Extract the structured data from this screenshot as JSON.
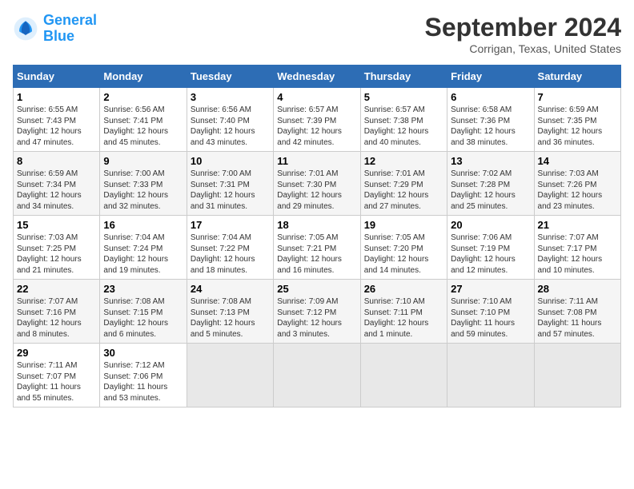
{
  "header": {
    "logo_line1": "General",
    "logo_line2": "Blue",
    "month_title": "September 2024",
    "location": "Corrigan, Texas, United States"
  },
  "weekdays": [
    "Sunday",
    "Monday",
    "Tuesday",
    "Wednesday",
    "Thursday",
    "Friday",
    "Saturday"
  ],
  "weeks": [
    [
      {
        "day": "1",
        "info": "Sunrise: 6:55 AM\nSunset: 7:43 PM\nDaylight: 12 hours\nand 47 minutes."
      },
      {
        "day": "2",
        "info": "Sunrise: 6:56 AM\nSunset: 7:41 PM\nDaylight: 12 hours\nand 45 minutes."
      },
      {
        "day": "3",
        "info": "Sunrise: 6:56 AM\nSunset: 7:40 PM\nDaylight: 12 hours\nand 43 minutes."
      },
      {
        "day": "4",
        "info": "Sunrise: 6:57 AM\nSunset: 7:39 PM\nDaylight: 12 hours\nand 42 minutes."
      },
      {
        "day": "5",
        "info": "Sunrise: 6:57 AM\nSunset: 7:38 PM\nDaylight: 12 hours\nand 40 minutes."
      },
      {
        "day": "6",
        "info": "Sunrise: 6:58 AM\nSunset: 7:36 PM\nDaylight: 12 hours\nand 38 minutes."
      },
      {
        "day": "7",
        "info": "Sunrise: 6:59 AM\nSunset: 7:35 PM\nDaylight: 12 hours\nand 36 minutes."
      }
    ],
    [
      {
        "day": "8",
        "info": "Sunrise: 6:59 AM\nSunset: 7:34 PM\nDaylight: 12 hours\nand 34 minutes."
      },
      {
        "day": "9",
        "info": "Sunrise: 7:00 AM\nSunset: 7:33 PM\nDaylight: 12 hours\nand 32 minutes."
      },
      {
        "day": "10",
        "info": "Sunrise: 7:00 AM\nSunset: 7:31 PM\nDaylight: 12 hours\nand 31 minutes."
      },
      {
        "day": "11",
        "info": "Sunrise: 7:01 AM\nSunset: 7:30 PM\nDaylight: 12 hours\nand 29 minutes."
      },
      {
        "day": "12",
        "info": "Sunrise: 7:01 AM\nSunset: 7:29 PM\nDaylight: 12 hours\nand 27 minutes."
      },
      {
        "day": "13",
        "info": "Sunrise: 7:02 AM\nSunset: 7:28 PM\nDaylight: 12 hours\nand 25 minutes."
      },
      {
        "day": "14",
        "info": "Sunrise: 7:03 AM\nSunset: 7:26 PM\nDaylight: 12 hours\nand 23 minutes."
      }
    ],
    [
      {
        "day": "15",
        "info": "Sunrise: 7:03 AM\nSunset: 7:25 PM\nDaylight: 12 hours\nand 21 minutes."
      },
      {
        "day": "16",
        "info": "Sunrise: 7:04 AM\nSunset: 7:24 PM\nDaylight: 12 hours\nand 19 minutes."
      },
      {
        "day": "17",
        "info": "Sunrise: 7:04 AM\nSunset: 7:22 PM\nDaylight: 12 hours\nand 18 minutes."
      },
      {
        "day": "18",
        "info": "Sunrise: 7:05 AM\nSunset: 7:21 PM\nDaylight: 12 hours\nand 16 minutes."
      },
      {
        "day": "19",
        "info": "Sunrise: 7:05 AM\nSunset: 7:20 PM\nDaylight: 12 hours\nand 14 minutes."
      },
      {
        "day": "20",
        "info": "Sunrise: 7:06 AM\nSunset: 7:19 PM\nDaylight: 12 hours\nand 12 minutes."
      },
      {
        "day": "21",
        "info": "Sunrise: 7:07 AM\nSunset: 7:17 PM\nDaylight: 12 hours\nand 10 minutes."
      }
    ],
    [
      {
        "day": "22",
        "info": "Sunrise: 7:07 AM\nSunset: 7:16 PM\nDaylight: 12 hours\nand 8 minutes."
      },
      {
        "day": "23",
        "info": "Sunrise: 7:08 AM\nSunset: 7:15 PM\nDaylight: 12 hours\nand 6 minutes."
      },
      {
        "day": "24",
        "info": "Sunrise: 7:08 AM\nSunset: 7:13 PM\nDaylight: 12 hours\nand 5 minutes."
      },
      {
        "day": "25",
        "info": "Sunrise: 7:09 AM\nSunset: 7:12 PM\nDaylight: 12 hours\nand 3 minutes."
      },
      {
        "day": "26",
        "info": "Sunrise: 7:10 AM\nSunset: 7:11 PM\nDaylight: 12 hours\nand 1 minute."
      },
      {
        "day": "27",
        "info": "Sunrise: 7:10 AM\nSunset: 7:10 PM\nDaylight: 11 hours\nand 59 minutes."
      },
      {
        "day": "28",
        "info": "Sunrise: 7:11 AM\nSunset: 7:08 PM\nDaylight: 11 hours\nand 57 minutes."
      }
    ],
    [
      {
        "day": "29",
        "info": "Sunrise: 7:11 AM\nSunset: 7:07 PM\nDaylight: 11 hours\nand 55 minutes."
      },
      {
        "day": "30",
        "info": "Sunrise: 7:12 AM\nSunset: 7:06 PM\nDaylight: 11 hours\nand 53 minutes."
      },
      {
        "day": "",
        "info": ""
      },
      {
        "day": "",
        "info": ""
      },
      {
        "day": "",
        "info": ""
      },
      {
        "day": "",
        "info": ""
      },
      {
        "day": "",
        "info": ""
      }
    ]
  ]
}
